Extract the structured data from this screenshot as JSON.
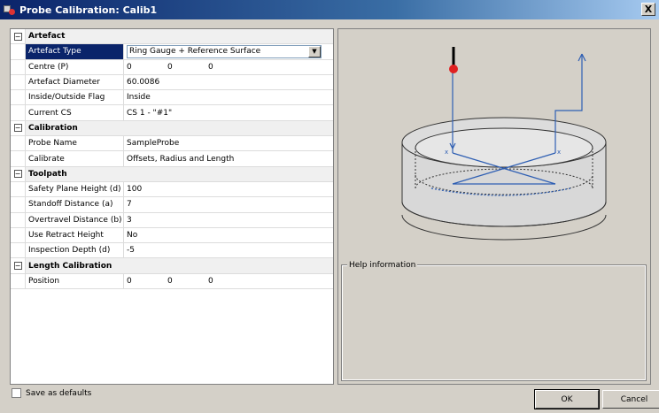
{
  "window": {
    "title": "Probe Calibration: Calib1",
    "close_label": "X"
  },
  "grid": {
    "artefact": {
      "title": "Artefact",
      "rows": [
        {
          "name": "Artefact Type",
          "value": "Ring Gauge + Reference Surface"
        },
        {
          "name": "Centre (P)",
          "values": [
            "0",
            "0",
            "0"
          ]
        },
        {
          "name": "Artefact Diameter",
          "value": "60.0086"
        },
        {
          "name": "Inside/Outside Flag",
          "value": "Inside"
        },
        {
          "name": "Current CS",
          "value": "CS 1 - \"#1\""
        }
      ]
    },
    "calibration": {
      "title": "Calibration",
      "rows": [
        {
          "name": "Probe Name",
          "value": "SampleProbe"
        },
        {
          "name": "Calibrate",
          "value": "Offsets, Radius and Length"
        }
      ]
    },
    "toolpath": {
      "title": "Toolpath",
      "rows": [
        {
          "name": "Safety Plane Height (d)",
          "value": "100"
        },
        {
          "name": "Standoff Distance (a)",
          "value": "7"
        },
        {
          "name": "Overtravel Distance (b)",
          "value": "3"
        },
        {
          "name": "Use Retract Height",
          "value": "No"
        },
        {
          "name": "Inspection Depth (d)",
          "value": "-5"
        }
      ]
    },
    "length": {
      "title": "Length Calibration",
      "rows": [
        {
          "name": "Position",
          "values": [
            "0",
            "0",
            "0"
          ]
        }
      ]
    },
    "expander_symbol": "⊟"
  },
  "help": {
    "label": "Help information"
  },
  "footer": {
    "save_defaults": "Save as defaults",
    "ok": "OK",
    "cancel": "Cancel"
  },
  "colors": {
    "selection": "#0a246a",
    "titlebar": "#0a246a",
    "probe_tip": "#e02020",
    "toolpath": "#2f5fb3"
  }
}
